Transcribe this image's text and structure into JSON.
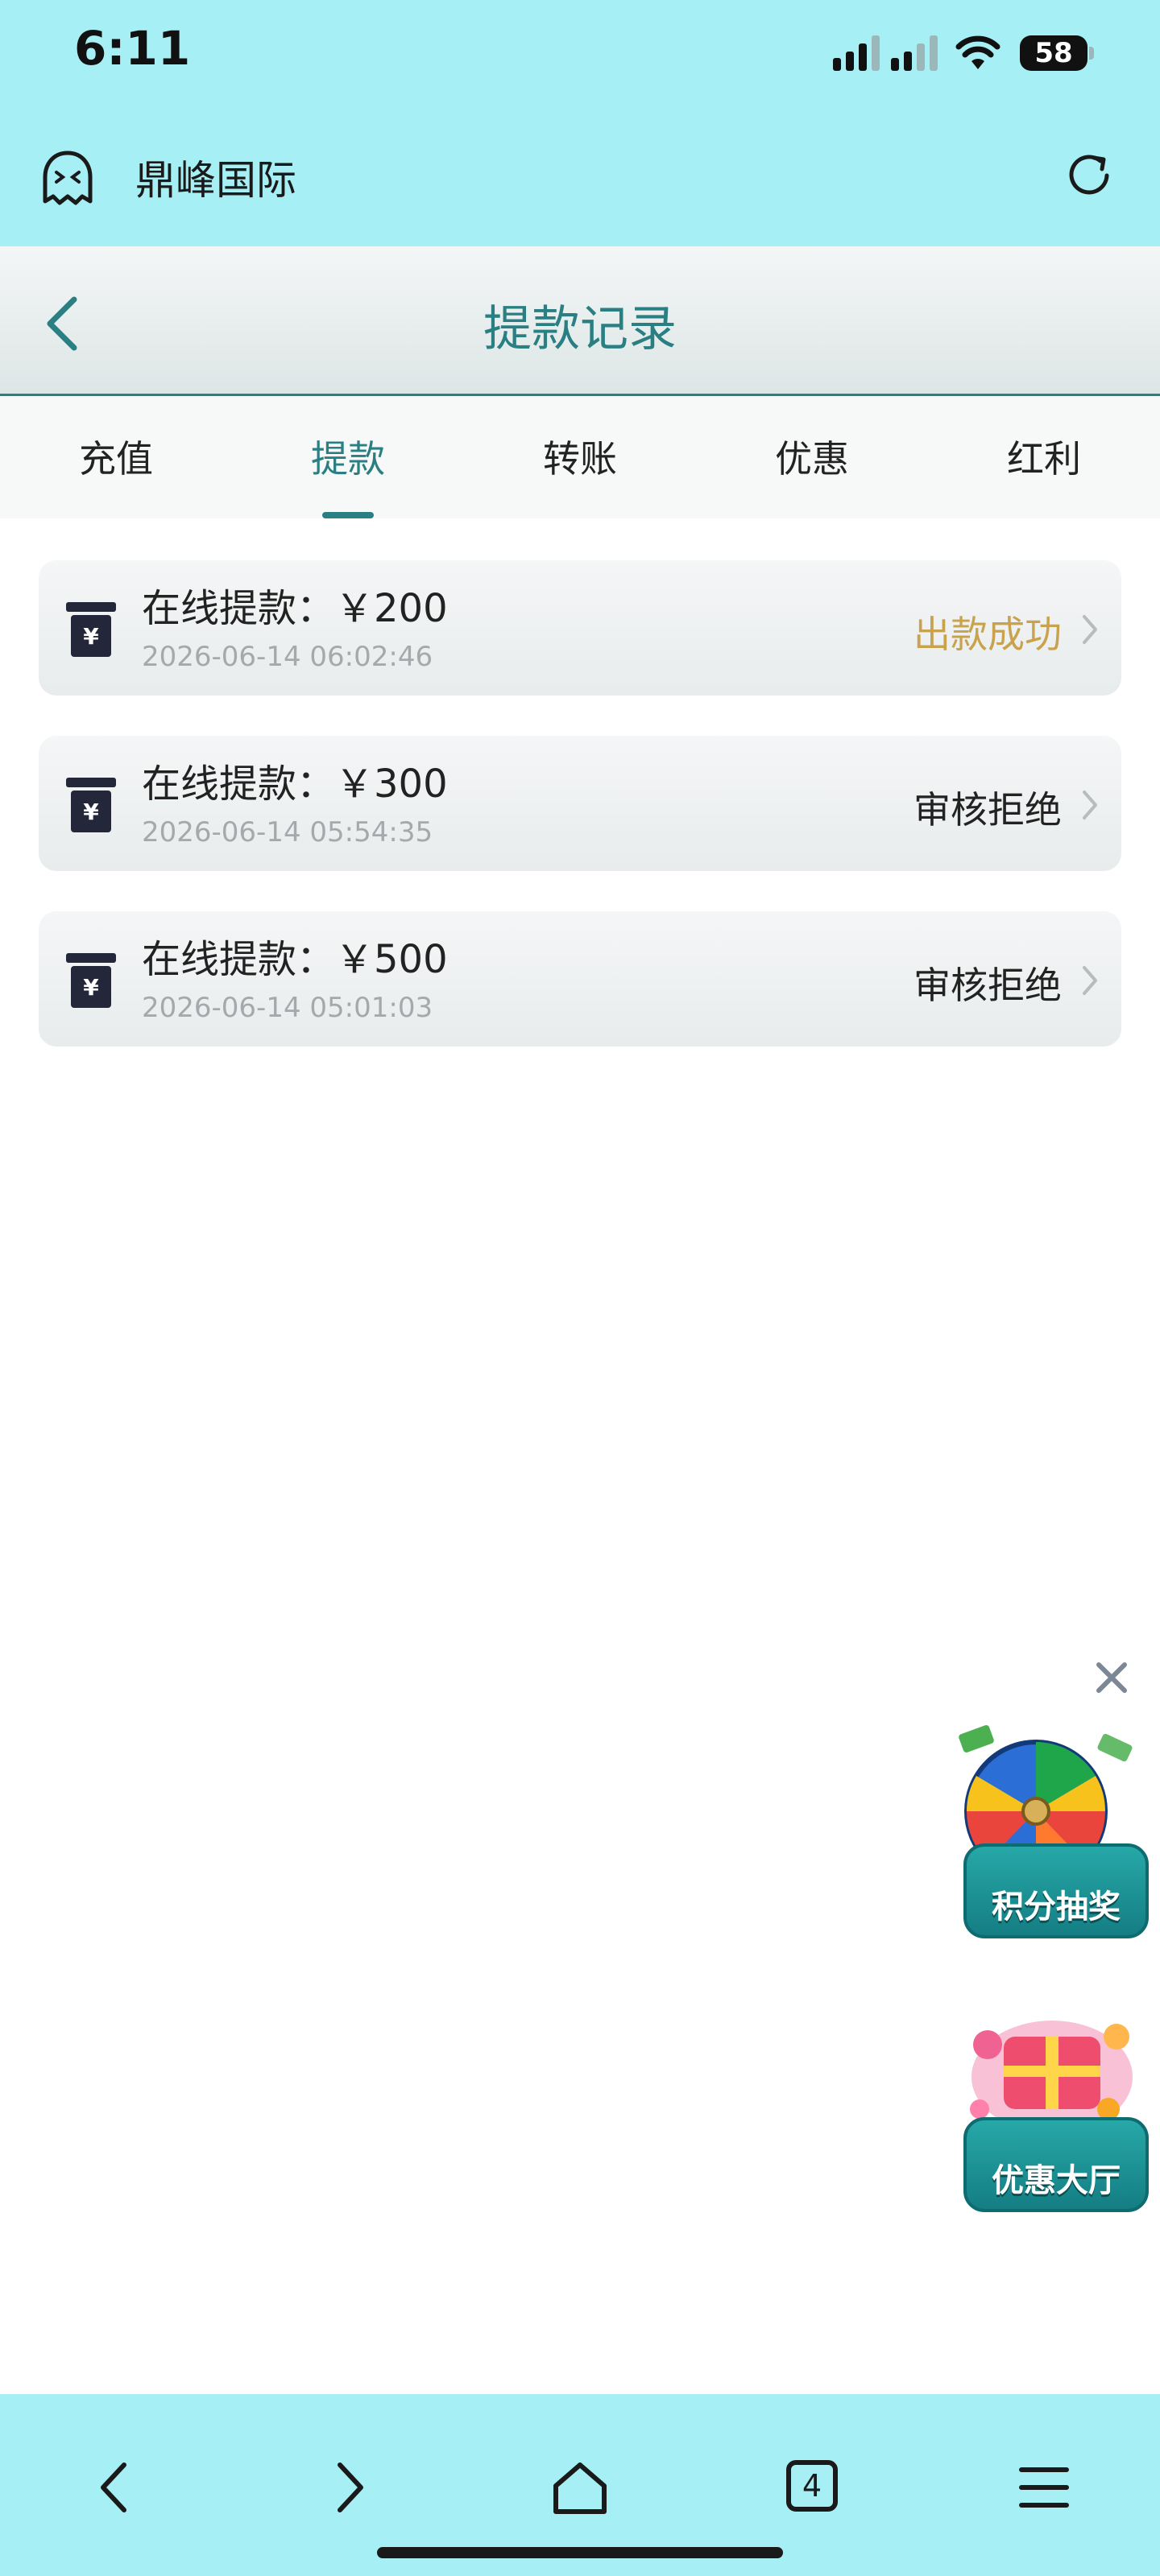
{
  "status_bar": {
    "time": "6:11",
    "battery": "58"
  },
  "browser": {
    "site_title": "鼎峰国际",
    "tabs_count": "4"
  },
  "page": {
    "title": "提款记录"
  },
  "tabs": [
    {
      "label": "充值"
    },
    {
      "label": "提款"
    },
    {
      "label": "转账"
    },
    {
      "label": "优惠"
    },
    {
      "label": "红利"
    }
  ],
  "active_tab": "提款",
  "records": [
    {
      "title": "在线提款：￥200",
      "time": "2026-06-14 06:02:46",
      "status": "出款成功"
    },
    {
      "title": "在线提款：￥300",
      "time": "2026-06-14 05:54:35",
      "status": "审核拒绝"
    },
    {
      "title": "在线提款：￥500",
      "time": "2026-06-14 05:01:03",
      "status": "审核拒绝"
    }
  ],
  "promos": {
    "lottery_label": "积分抽奖",
    "deals_label": "优惠大厅"
  },
  "colors": {
    "bar_bg": "#a6eff4",
    "accent": "#2a7f82",
    "success": "#c9a24e",
    "text": "#222222",
    "muted": "#a6a9ab"
  }
}
